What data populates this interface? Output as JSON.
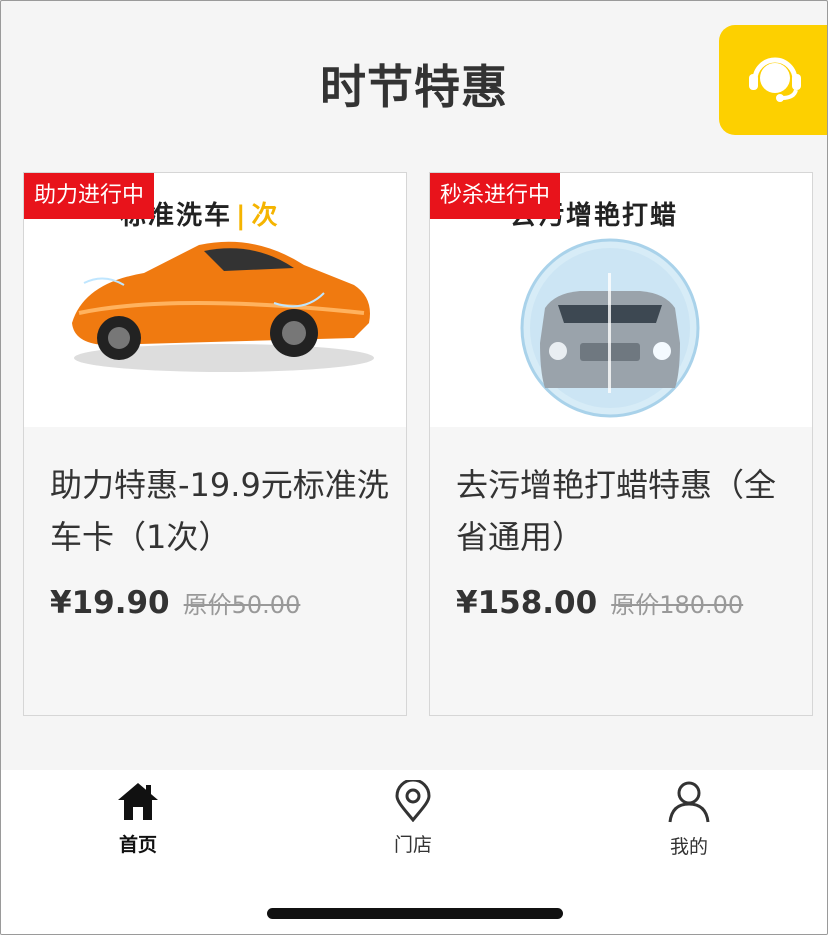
{
  "header": {
    "title": "时节特惠",
    "service_icon": "headset-icon"
  },
  "cards": [
    {
      "badge": "助力进行中",
      "image_caption": "标准洗车",
      "image_caption_count": "次",
      "name": "助力特惠-19.9元标准洗车卡（1次）",
      "price": "¥19.90",
      "original_price": "原价50.00"
    },
    {
      "badge": "秒杀进行中",
      "image_caption": "去污增艳打蜡",
      "name": "去污增艳打蜡特惠（全省通用）",
      "price": "¥158.00",
      "original_price": "原价180.00"
    }
  ],
  "tabbar": {
    "items": [
      {
        "label": "首页",
        "icon": "home-icon",
        "active": true
      },
      {
        "label": "门店",
        "icon": "location-pin-icon",
        "active": false
      },
      {
        "label": "我的",
        "icon": "user-icon",
        "active": false
      }
    ]
  },
  "colors": {
    "accent_yellow": "#fdd000",
    "badge_red": "#e8131b"
  }
}
